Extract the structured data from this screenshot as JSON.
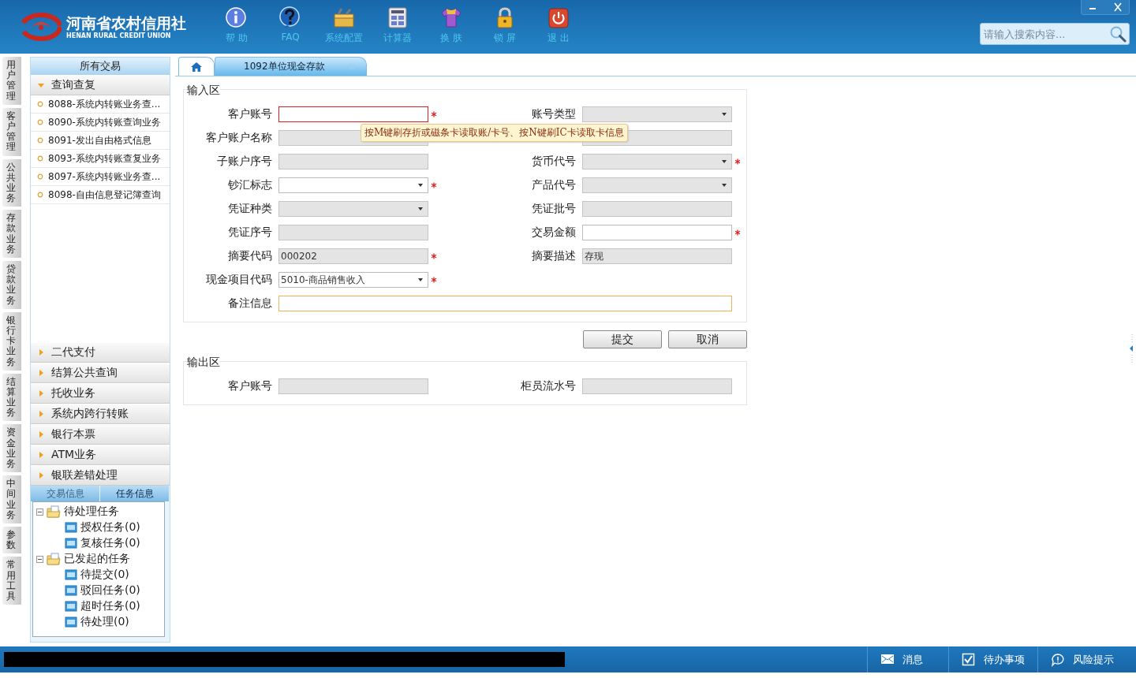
{
  "header": {
    "logo": {
      "name": "河南省农村信用社",
      "subtitle": "HENAN RURAL CREDIT UNION"
    },
    "toolbar": [
      {
        "kind": "info",
        "label": "帮 助"
      },
      {
        "kind": "question",
        "label": "FAQ"
      },
      {
        "kind": "toolbox",
        "label": "系统配置"
      },
      {
        "kind": "calculator",
        "label": "计算器"
      },
      {
        "kind": "shirt",
        "label": "换 肤"
      },
      {
        "kind": "lock",
        "label": "锁 屏"
      },
      {
        "kind": "power",
        "label": "退 出"
      }
    ],
    "search": {
      "placeholder": "请输入搜索内容..."
    }
  },
  "side_tabs": [
    "用户管理",
    "客户管理",
    "公共业务",
    "存款业务",
    "贷款业务",
    "银行卡业务",
    "结算业务",
    "资金业务",
    "中间业务",
    "参数",
    "常用工具"
  ],
  "sidebar": {
    "title": "所有交易",
    "groups": [
      {
        "label": "查询查复",
        "expanded": true,
        "items": [
          "8088-系统内转账业务查...",
          "8090-系统内转账查询业务",
          "8091-发出自由格式信息",
          "8093-系统内转账查复业务",
          "8097-系统内转账业务查...",
          "8098-自由信息登记簿查询"
        ]
      },
      {
        "label": "二代支付",
        "expanded": false
      },
      {
        "label": "结算公共查询",
        "expanded": false
      },
      {
        "label": "托收业务",
        "expanded": false
      },
      {
        "label": "系统内跨行转账",
        "expanded": false
      },
      {
        "label": "银行本票",
        "expanded": false
      },
      {
        "label": "ATM业务",
        "expanded": false
      },
      {
        "label": "银联差错处理",
        "expanded": false
      }
    ],
    "info_tabs": [
      {
        "label": "交易信息",
        "selected": false
      },
      {
        "label": "任务信息",
        "selected": true
      }
    ],
    "task_tree": [
      {
        "label": "待处理任务",
        "expanded": true,
        "children": [
          {
            "label": "授权任务(0)"
          },
          {
            "label": "复核任务(0)"
          }
        ]
      },
      {
        "label": "已发起的任务",
        "expanded": true,
        "children": [
          {
            "label": "待提交(0)"
          },
          {
            "label": "驳回任务(0)"
          },
          {
            "label": "超时任务(0)"
          },
          {
            "label": "待处理(0)"
          }
        ]
      }
    ]
  },
  "tabs": [
    {
      "kind": "home",
      "selected": false
    },
    {
      "kind": "page",
      "label": "1092单位现金存款",
      "selected": true
    }
  ],
  "input_section": {
    "title": "输入区",
    "fields": [
      {
        "label": "客户账号",
        "kind": "text",
        "disabled": false,
        "required": true,
        "invalid": true,
        "focused": false
      },
      {
        "label": "账号类型",
        "kind": "select",
        "disabled": true,
        "required": false,
        "invalid": false,
        "focused": false
      },
      {
        "label": "客户账户名称",
        "kind": "text",
        "disabled": true,
        "required": false,
        "invalid": false,
        "focused": false
      },
      {
        "kind": "text",
        "disabled": true,
        "required": false,
        "invalid": false,
        "focused": false
      },
      {
        "label": "子账户序号",
        "kind": "text",
        "disabled": true,
        "required": false,
        "invalid": false,
        "focused": false
      },
      {
        "label": "货币代号",
        "kind": "select",
        "disabled": true,
        "required": true,
        "invalid": false,
        "focused": false
      },
      {
        "label": "钞汇标志",
        "kind": "select",
        "disabled": false,
        "required": true,
        "invalid": false,
        "focused": false
      },
      {
        "label": "产品代号",
        "kind": "select",
        "disabled": true,
        "required": false,
        "invalid": false,
        "focused": false
      },
      {
        "label": "凭证种类",
        "kind": "select",
        "disabled": true,
        "required": false,
        "invalid": false,
        "focused": false
      },
      {
        "label": "凭证批号",
        "kind": "text",
        "disabled": true,
        "required": false,
        "invalid": false,
        "focused": false
      },
      {
        "label": "凭证序号",
        "kind": "text",
        "disabled": true,
        "required": false,
        "invalid": false,
        "focused": false
      },
      {
        "label": "交易金额",
        "kind": "text",
        "disabled": false,
        "required": true,
        "invalid": false,
        "focused": false
      },
      {
        "label": "摘要代码",
        "kind": "text",
        "value": "000202",
        "disabled": true,
        "required": true,
        "invalid": false,
        "focused": false
      },
      {
        "label": "摘要描述",
        "kind": "text",
        "value": "存现",
        "disabled": true,
        "required": false,
        "invalid": false,
        "focused": false
      },
      {
        "label": "现金项目代码",
        "kind": "select",
        "value": "5010-商品销售收入",
        "disabled": false,
        "required": true,
        "invalid": false,
        "focused": false
      },
      {
        "kind": "gap"
      },
      {
        "label": "备注信息",
        "kind": "wide",
        "disabled": false,
        "required": false,
        "invalid": false,
        "focused": true
      }
    ],
    "tooltip": "按M键刷存折或磁条卡读取账/卡号、按N键刷IC卡读取卡信息"
  },
  "buttons": [
    "提交",
    "取消"
  ],
  "output_section": {
    "title": "输出区",
    "fields": [
      {
        "label": "客户账号",
        "kind": "text",
        "disabled": true,
        "required": false,
        "invalid": false,
        "focused": false
      },
      {
        "label": "柜员流水号",
        "kind": "text",
        "disabled": true,
        "required": false,
        "invalid": false,
        "focused": false
      }
    ]
  },
  "status_bar": [
    {
      "kind": "mail",
      "label": "消息"
    },
    {
      "kind": "check",
      "label": "待办事项"
    },
    {
      "kind": "bubble",
      "label": "风险提示"
    }
  ]
}
